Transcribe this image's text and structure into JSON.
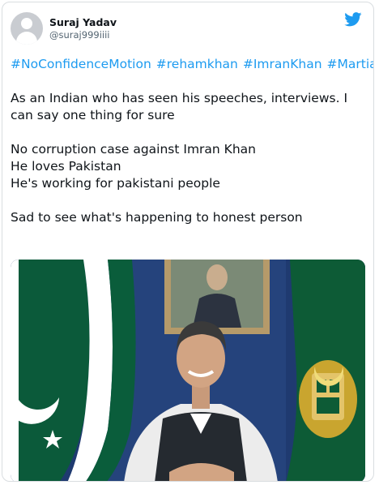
{
  "tweet": {
    "display_name": "Suraj Yadav",
    "handle": "@suraj999iiii",
    "hashtags": [
      "#NoConfidenceMotion",
      "#rehamkhan",
      "#ImranKhan",
      "#Martial_law"
    ],
    "paragraph_1": "As an Indian who has seen his speeches, interviews. I can say one thing for sure",
    "line_1": "No corruption case against Imran Khan",
    "line_2": "He loves Pakistan",
    "line_3": "He's working for pakistani people",
    "closing": "Sad to see what's happening to honest person"
  },
  "icons": {
    "logo": "twitter-bird-icon",
    "avatar": "default-avatar"
  },
  "colors": {
    "link": "#1d9bf0",
    "brand": "#1d9bf0",
    "text": "#0f1419",
    "secondary": "#536471"
  }
}
